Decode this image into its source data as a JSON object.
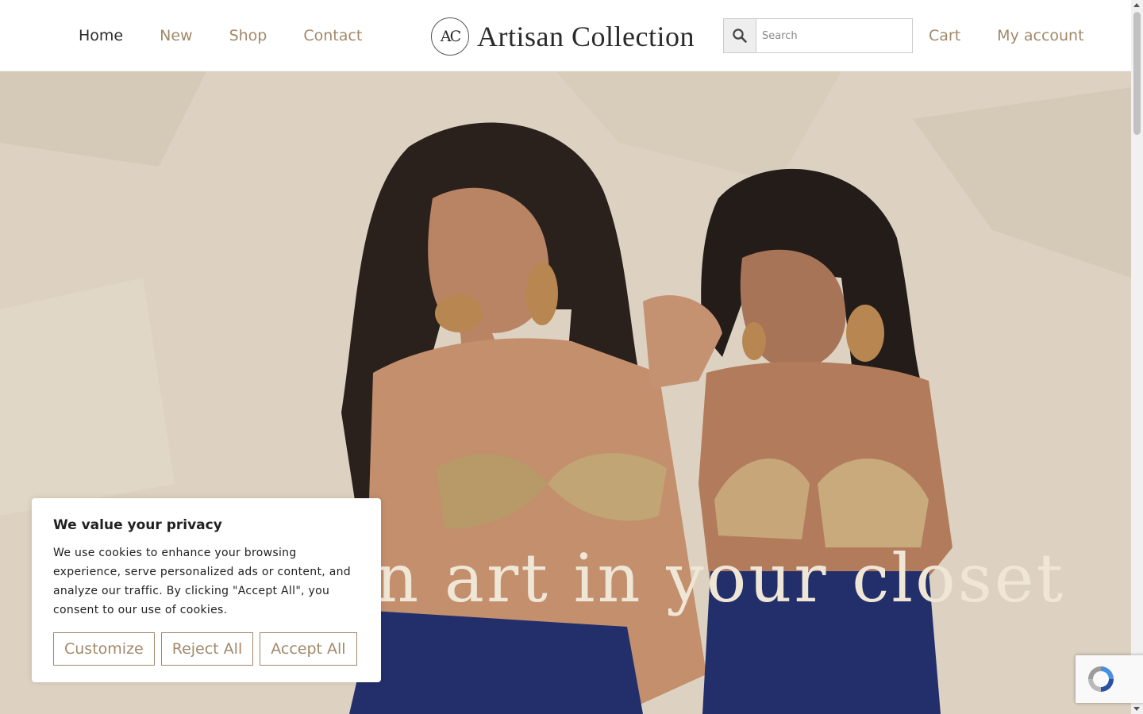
{
  "header": {
    "nav_left": [
      {
        "label": "Home",
        "active": true
      },
      {
        "label": "New",
        "active": false
      },
      {
        "label": "Shop",
        "active": false
      },
      {
        "label": "Contact",
        "active": false
      }
    ],
    "logo": {
      "monogram": "AC",
      "text": "Artisan Collection"
    },
    "search": {
      "placeholder": "Search",
      "icon": "search-icon"
    },
    "nav_right": [
      {
        "label": "Cart"
      },
      {
        "label": "My account"
      }
    ]
  },
  "hero": {
    "tagline": "an art in your closet"
  },
  "cookie_banner": {
    "title": "We value your privacy",
    "body": "We use cookies to enhance your browsing experience, serve personalized ads or content, and analyze our traffic. By clicking \"Accept All\", you consent to our use of cookies.",
    "buttons": {
      "customize": "Customize",
      "reject": "Reject All",
      "accept": "Accept All"
    }
  },
  "colors": {
    "accent": "#a1896a",
    "text_dark": "#2b2b2b",
    "tagline": "#efe6d6",
    "background_wall": "#ded3c2",
    "skirt_navy": "#222f6b"
  },
  "recaptcha": {
    "icon": "recaptcha-icon"
  }
}
